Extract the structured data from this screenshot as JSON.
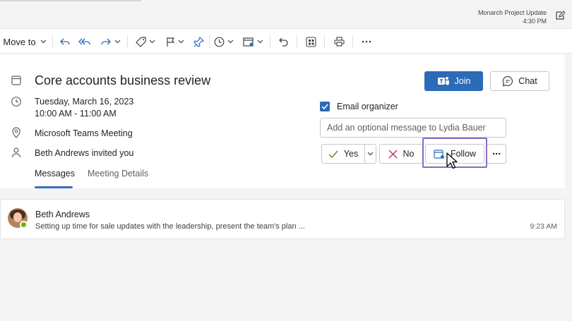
{
  "notification": {
    "title": "Monarch Project Update",
    "time": "4:30 PM"
  },
  "toolbar": {
    "move_to": "Move to"
  },
  "event": {
    "title": "Core accounts business review",
    "date": "Tuesday, March 16, 2023",
    "time": "10:00 AM - 11:00 AM",
    "location": "Microsoft Teams Meeting",
    "invite": "Beth Andrews invited you"
  },
  "tabs": [
    {
      "label": "Messages"
    },
    {
      "label": "Meeting Details"
    }
  ],
  "actions": {
    "join": "Join",
    "chat": "Chat",
    "email_organizer": "Email organizer",
    "message_placeholder": "Add an optional message to Lydia Bauer",
    "yes": "Yes",
    "no": "No",
    "follow": "Follow"
  },
  "messages": [
    {
      "sender": "Beth Andrews",
      "preview": "Setting up time for sale updates with the leadership, present the team's plan ...",
      "time": "9:23 AM"
    }
  ],
  "colors": {
    "accent": "#2b6bb8",
    "highlight": "#8c6bc2",
    "presence": "#6bb700"
  }
}
